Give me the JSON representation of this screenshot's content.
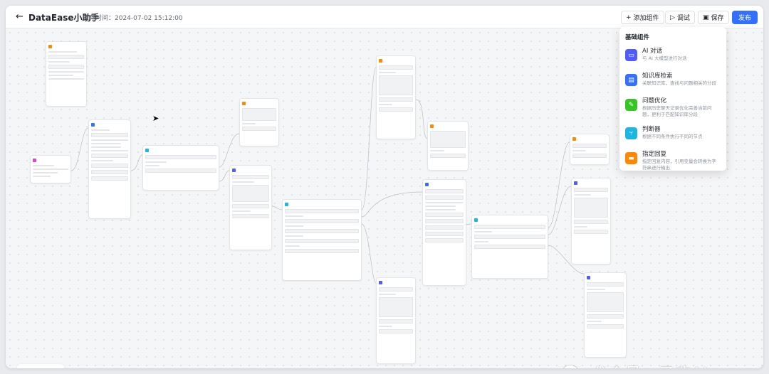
{
  "header": {
    "back_icon": "arrow-left-icon",
    "title": "DataEase小助手",
    "save_time": "保存时间：2024-07-02 15:12:00",
    "buttons": {
      "add_component": "添加组件",
      "debug": "调试",
      "save": "保存",
      "publish": "发布"
    }
  },
  "components_menu": {
    "heading": "基础组件",
    "items": [
      {
        "icon": "chat-icon",
        "name": "AI 对话",
        "desc": "与 AI 大模型进行对话",
        "color": "#4f5bff"
      },
      {
        "icon": "knowledge-icon",
        "name": "知识库检索",
        "desc": "关联知识库，查找与问题相关的分段",
        "color": "#3370ff"
      },
      {
        "icon": "optimize-icon",
        "name": "问题优化",
        "desc": "根据历史聊天记录优化完善当前问题，更利于匹配知识库分段",
        "color": "#34c724"
      },
      {
        "icon": "branch-icon",
        "name": "判断器",
        "desc": "根据不同条件执行不同的节点",
        "color": "#1ab7e5"
      },
      {
        "icon": "reply-icon",
        "name": "指定回复",
        "desc": "指定回复内容，引用变量会转换为字符串进行输出",
        "color": "#ff8800"
      }
    ]
  },
  "zoom_controls": {
    "zoom_out": "⊖",
    "zoom_in": "⊕",
    "fit": "⛶"
  },
  "watermark": {
    "text": "公众号 · 子非AI"
  },
  "colors": {
    "primary": "#3370ff",
    "orange": "#ff8800",
    "pink": "#e83ecf",
    "blue": "#3370ff",
    "green": "#34c724"
  }
}
